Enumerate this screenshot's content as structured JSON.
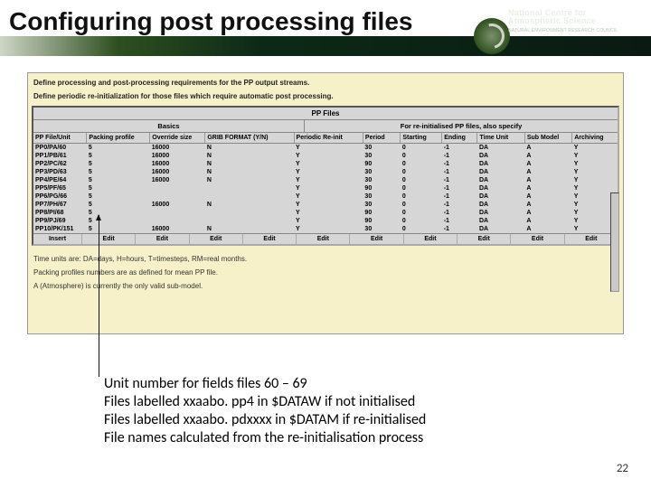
{
  "header": {
    "title": "Configuring post processing files",
    "logo_line1": "National Centre for",
    "logo_line2": "Atmospheric Science",
    "logo_sub": "NATURAL ENVIRONMENT RESEARCH COUNCIL"
  },
  "panel": {
    "intro": [
      "Define processing and post-processing requirements for the PP output streams.",
      "Define periodic re-initialization for those files which require automatic post processing."
    ],
    "pp_title": "PP Files",
    "section_left": "Basics",
    "section_right": "For re-initialised PP files, also specify",
    "columns": [
      "PP File/Unit",
      "Packing profile",
      "Override size",
      "GRIB FORMAT (Y/N)",
      "Periodic Re-init",
      "Period",
      "Starting",
      "Ending",
      "Time Unit",
      "Sub Model",
      "Archiving"
    ],
    "rows": [
      {
        "file": "PP0/PA/60",
        "pack": "5",
        "override": "",
        "size": "16000",
        "grib": "N",
        "reinit": "Y",
        "period": "30",
        "start": "0",
        "end": "-1",
        "unit": "DA",
        "sub": "A",
        "arch": "Y"
      },
      {
        "file": "PP1/PB/61",
        "pack": "5",
        "override": "",
        "size": "16000",
        "grib": "N",
        "reinit": "Y",
        "period": "30",
        "start": "0",
        "end": "-1",
        "unit": "DA",
        "sub": "A",
        "arch": "Y"
      },
      {
        "file": "PP2/PC/62",
        "pack": "5",
        "override": "",
        "size": "16000",
        "grib": "N",
        "reinit": "Y",
        "period": "90",
        "start": "0",
        "end": "-1",
        "unit": "DA",
        "sub": "A",
        "arch": "Y"
      },
      {
        "file": "PP3/PD/63",
        "pack": "5",
        "override": "",
        "size": "16000",
        "grib": "N",
        "reinit": "Y",
        "period": "30",
        "start": "0",
        "end": "-1",
        "unit": "DA",
        "sub": "A",
        "arch": "Y"
      },
      {
        "file": "PP4/PE/64",
        "pack": "5",
        "override": "",
        "size": "16000",
        "grib": "N",
        "reinit": "Y",
        "period": "30",
        "start": "0",
        "end": "-1",
        "unit": "DA",
        "sub": "A",
        "arch": "Y"
      },
      {
        "file": "PP5/PF/65",
        "pack": "5",
        "override": "",
        "size": "",
        "grib": "",
        "reinit": "Y",
        "period": "90",
        "start": "0",
        "end": "-1",
        "unit": "DA",
        "sub": "A",
        "arch": "Y"
      },
      {
        "file": "PP6/PG/66",
        "pack": "5",
        "override": "",
        "size": "",
        "grib": "",
        "reinit": "Y",
        "period": "30",
        "start": "0",
        "end": "-1",
        "unit": "DA",
        "sub": "A",
        "arch": "Y"
      },
      {
        "file": "PP7/PH/67",
        "pack": "5",
        "override": "",
        "size": "16000",
        "grib": "N",
        "reinit": "Y",
        "period": "30",
        "start": "0",
        "end": "-1",
        "unit": "DA",
        "sub": "A",
        "arch": "Y"
      },
      {
        "file": "PP8/PI/68",
        "pack": "5",
        "override": "",
        "size": "",
        "grib": "",
        "reinit": "Y",
        "period": "90",
        "start": "0",
        "end": "-1",
        "unit": "DA",
        "sub": "A",
        "arch": "Y"
      },
      {
        "file": "PP9/PJ/69",
        "pack": "5",
        "override": "",
        "size": "",
        "grib": "",
        "reinit": "Y",
        "period": "90",
        "start": "0",
        "end": "-1",
        "unit": "DA",
        "sub": "A",
        "arch": "Y"
      },
      {
        "file": "PP10/PK/151",
        "pack": "5",
        "override": "",
        "size": "16000",
        "grib": "N",
        "reinit": "Y",
        "period": "30",
        "start": "0",
        "end": "-1",
        "unit": "DA",
        "sub": "A",
        "arch": "Y"
      }
    ],
    "action_insert": "Insert",
    "action_edit": "Edit",
    "notes": [
      "Time units are: DA=days, H=hours, T=timesteps, RM=real months.",
      "Packing profiles numbers are as defined for mean PP file.",
      "A (Atmosphere) is currently the only valid sub-model."
    ]
  },
  "caption": {
    "l1": "Unit number for fields files 60 – 69",
    "l2": "Files labelled xxaabo. pp4 in $DATAW if not initialised",
    "l3": "Files labelled xxaabo. pdxxxx in $DATAM if re-initialised",
    "l4": "File names calculated from the re-initialisation process"
  },
  "page_number": "22"
}
